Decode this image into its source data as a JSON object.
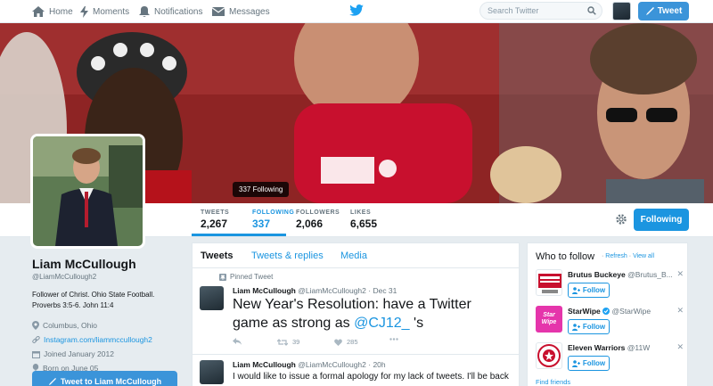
{
  "nav": {
    "home": "Home",
    "moments": "Moments",
    "notifications": "Notifications",
    "messages": "Messages",
    "search_placeholder": "Search Twitter",
    "tweet_button": "Tweet"
  },
  "header": {
    "tooltip": "337 Following"
  },
  "stats": [
    {
      "label": "TWEETS",
      "value": "2,267"
    },
    {
      "label": "FOLLOWING",
      "value": "337"
    },
    {
      "label": "FOLLOWERS",
      "value": "2,066"
    },
    {
      "label": "LIKES",
      "value": "6,655"
    }
  ],
  "profile_actions": {
    "following_button": "Following"
  },
  "profile": {
    "name": "Liam McCullough",
    "handle": "@LiamMcCullough2",
    "bio": "Follower of Christ. Ohio State Football. Proverbs 3:5-6. John 11:4",
    "location": "Columbus, Ohio",
    "website": "Instagram.com/liammccullough2",
    "joined": "Joined January 2012",
    "born": "Born on June 05",
    "tweet_to_button": "Tweet to Liam McCullough"
  },
  "timeline": {
    "tabs": [
      "Tweets",
      "Tweets & replies",
      "Media"
    ],
    "pinned_label": "Pinned Tweet",
    "tweets": [
      {
        "name": "Liam McCullough",
        "handle": "@LiamMcCullough2",
        "time": "Dec 31",
        "text_before": "New Year's Resolution: have a Twitter game as strong as ",
        "mention": "@CJ12_",
        "text_after": " 's",
        "retweets": "39",
        "likes": "285"
      },
      {
        "name": "Liam McCullough",
        "handle": "@LiamMcCullough2",
        "time": "20h",
        "text": "I would like to issue a formal apology for my lack of tweets. I'll be back"
      }
    ]
  },
  "who_to_follow": {
    "title": "Who to follow",
    "refresh": "Refresh",
    "view_all": "View all",
    "follow_label": "Follow",
    "find_friends": "Find friends",
    "suggestions": [
      {
        "name": "Brutus Buckeye",
        "handle": "@Brutus_B...",
        "avatar_color": "#c8102e"
      },
      {
        "name": "StarWipe",
        "handle": "@StarWipe",
        "avatar_color": "#e535ab",
        "avatar_text": "Star Wipe"
      },
      {
        "name": "Eleven Warriors",
        "handle": "@11W",
        "avatar_color": "#ffffff"
      }
    ]
  },
  "colors": {
    "accent": "#1b95e0",
    "button": "#3b94d9",
    "scarlet": "#bb0000"
  }
}
